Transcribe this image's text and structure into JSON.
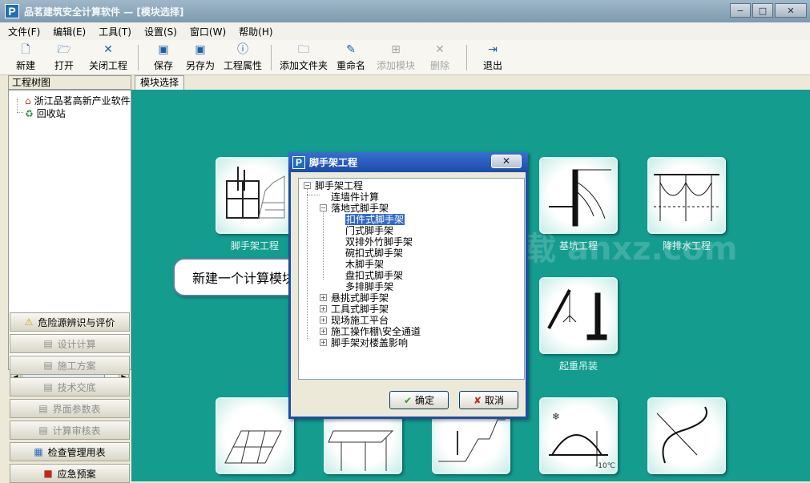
{
  "window": {
    "title": "品茗建筑安全计算软件 — [模块选择]",
    "controls": [
      "−",
      "□",
      "✕"
    ]
  },
  "menu": [
    "文件(F)",
    "编辑(E)",
    "工具(T)",
    "设置(S)",
    "窗口(W)",
    "帮助(H)"
  ],
  "toolbar": {
    "new": "新建",
    "open": "打开",
    "close_project": "关闭工程",
    "save": "保存",
    "save_as": "另存为",
    "properties": "工程属性",
    "add_folder": "添加文件夹",
    "rename": "重命名",
    "add_module": "添加模块",
    "delete": "删除",
    "exit": "退出"
  },
  "left_panel": {
    "header": "工程树图",
    "tree": [
      "浙江品茗高新产业软件",
      "回收站"
    ],
    "buttons": [
      "危险源辨识与评价",
      "设计计算",
      "施工方案",
      "技术交底",
      "界面参数表",
      "计算审核表",
      "检查管理用表",
      "应急预案"
    ]
  },
  "tab": "模块选择",
  "modules": [
    "脚手架工程",
    "基坑工程",
    "降排水工程",
    "起重吊装"
  ],
  "watermark": "安下载 anxz.com",
  "dialog": {
    "title": "脚手架工程",
    "close": "✕",
    "tree": {
      "root": "脚手架工程",
      "wall": "连墙件计算",
      "floor": "落地式脚手架",
      "floor_children": [
        "扣件式脚手架",
        "门式脚手架",
        "双排外竹脚手架",
        "碗扣式脚手架",
        "木脚手架",
        "盘扣式脚手架",
        "多排脚手架"
      ],
      "others": [
        "悬挑式脚手架",
        "工具式脚手架",
        "现场施工平台",
        "施工操作棚\\安全通道",
        "脚手架对楼盖影响"
      ]
    },
    "ok": "确定",
    "cancel": "取消"
  },
  "callout": "新建一个计算模块"
}
